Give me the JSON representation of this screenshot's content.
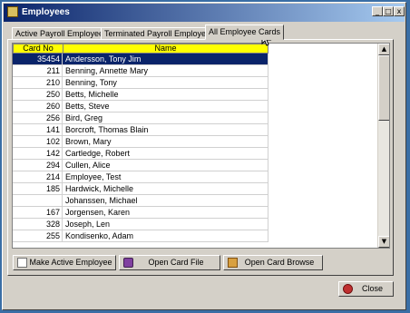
{
  "window": {
    "title": "Employees"
  },
  "titlebar_buttons": {
    "minimize": "_",
    "maximize": "□",
    "close": "x"
  },
  "tabs": [
    {
      "label": "Active Payroll Employees",
      "active": false
    },
    {
      "label": "Terminated Payroll Employees",
      "active": false
    },
    {
      "label": "All Employee Cards",
      "active": true
    }
  ],
  "grid": {
    "columns": [
      "Card No",
      "Name"
    ],
    "rows": [
      {
        "card_no": "35454",
        "name": "Andersson, Tony Jim",
        "selected": true
      },
      {
        "card_no": "211",
        "name": "Benning, Annette Mary"
      },
      {
        "card_no": "210",
        "name": "Benning, Tony"
      },
      {
        "card_no": "250",
        "name": "Betts, Michelle"
      },
      {
        "card_no": "260",
        "name": "Betts, Steve"
      },
      {
        "card_no": "256",
        "name": "Bird, Greg"
      },
      {
        "card_no": "141",
        "name": "Borcroft, Thomas Blain"
      },
      {
        "card_no": "102",
        "name": "Brown, Mary"
      },
      {
        "card_no": "142",
        "name": "Cartledge, Robert"
      },
      {
        "card_no": "294",
        "name": "Cullen, Alice"
      },
      {
        "card_no": "214",
        "name": "Employee, Test"
      },
      {
        "card_no": "185",
        "name": "Hardwick, Michelle"
      },
      {
        "card_no": "",
        "name": "Johanssen, Michael"
      },
      {
        "card_no": "167",
        "name": "Jorgensen, Karen"
      },
      {
        "card_no": "328",
        "name": "Joseph, Len"
      },
      {
        "card_no": "255",
        "name": "Kondisenko, Adam"
      }
    ]
  },
  "scrollbar": {
    "up": "▲",
    "down": "▼"
  },
  "buttons": {
    "make_active": "Make Active Employee",
    "open_card_file": "Open Card File",
    "open_card_browse": "Open Card Browse",
    "close": "Close"
  },
  "icons": {
    "title": "window-icon",
    "make_active": "document-icon",
    "open_card_file": "card-file-icon",
    "open_card_browse": "box-icon",
    "close": "close-icon"
  },
  "colors": {
    "title_start": "#0a246a",
    "title_end": "#a6caf0",
    "header_yellow": "#ffff00",
    "selection": "#0a246a",
    "desktop": "#3a6ea5"
  }
}
